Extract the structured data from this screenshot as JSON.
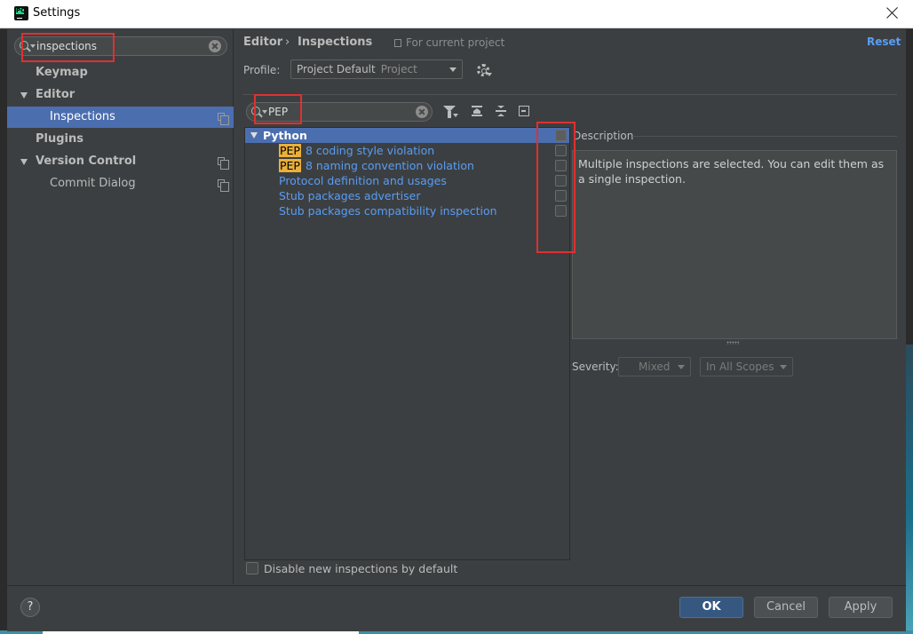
{
  "window": {
    "title": "Settings",
    "app_icon": "pycharm-icon"
  },
  "sidebar": {
    "search_value": "inspections",
    "items": [
      {
        "label": "Keymap"
      },
      {
        "label": "Editor"
      },
      {
        "label": "Inspections"
      },
      {
        "label": "Plugins"
      },
      {
        "label": "Version Control"
      },
      {
        "label": "Commit Dialog"
      }
    ]
  },
  "header": {
    "breadcrumb": [
      "Editor",
      "Inspections"
    ],
    "separator": "›",
    "scope_note": "For current project",
    "reset_label": "Reset"
  },
  "profile": {
    "label": "Profile:",
    "name": "Project Default",
    "scope": "Project"
  },
  "filter": {
    "value": "PEP"
  },
  "tree": {
    "group": "Python",
    "items": [
      {
        "highlight": "PEP",
        "rest": " 8 coding style violation"
      },
      {
        "highlight": "PEP",
        "rest": " 8 naming convention violation"
      },
      {
        "highlight": "",
        "rest": "Protocol definition and usages"
      },
      {
        "highlight": "",
        "rest": "Stub packages advertiser"
      },
      {
        "highlight": "",
        "rest": "Stub packages compatibility inspection"
      }
    ]
  },
  "description": {
    "title": "Description",
    "text": "Multiple inspections are selected. You can edit them as a single inspection."
  },
  "severity": {
    "label": "Severity:",
    "value": "Mixed",
    "scope": "In All Scopes"
  },
  "options": {
    "disable_new_label": "Disable new inspections by default"
  },
  "buttons": {
    "help": "?",
    "ok": "OK",
    "cancel": "Cancel",
    "apply": "Apply"
  },
  "colors": {
    "selection": "#4b6eaf",
    "link": "#589df6",
    "highlight": "#ebb03a",
    "annotation": "#e03030"
  }
}
